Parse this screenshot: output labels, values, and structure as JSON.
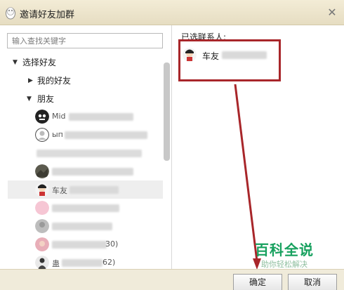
{
  "window": {
    "title": "邀请好友加群",
    "close_icon": "close-icon",
    "app_icon": "penguin-icon"
  },
  "search": {
    "placeholder": "输入查找关键字",
    "value": ""
  },
  "tree": {
    "root_label": "选择好友",
    "groups": [
      {
        "label": "我的好友",
        "expanded": false
      },
      {
        "label": "朋友",
        "expanded": true
      }
    ],
    "contacts": [
      {
        "name": "Mid",
        "avatar": "black-skull-avatar"
      },
      {
        "name": "ып",
        "avatar": "gray-circle-avatar"
      },
      {
        "name": "",
        "avatar": "none"
      },
      {
        "name": "",
        "avatar": "dark-landscape-avatar"
      },
      {
        "name": "车友",
        "avatar": "cartoon-avatar",
        "selected": true
      },
      {
        "name": "",
        "avatar": "pink-avatar"
      },
      {
        "name": "",
        "avatar": "pink-face-avatar"
      },
      {
        "name": "",
        "avatar": "gray-photo-avatar"
      },
      {
        "name": "",
        "avatar": "pink-photo-avatar",
        "suffix": "30)"
      },
      {
        "name": "蛊",
        "avatar": "dark-figure-avatar",
        "suffix": "62)"
      }
    ]
  },
  "right": {
    "selected_label": "已选联系人:",
    "selected_contacts": [
      {
        "name": "车友",
        "avatar": "cartoon-avatar"
      }
    ]
  },
  "watermark": {
    "main": "百科全说",
    "sub": "助你轻松解决"
  },
  "buttons": {
    "ok": "确定",
    "cancel": "取消"
  },
  "colors": {
    "annotation_red": "#a8262a",
    "watermark_green": "#18a15f",
    "title_bar": "#efe7cf"
  }
}
